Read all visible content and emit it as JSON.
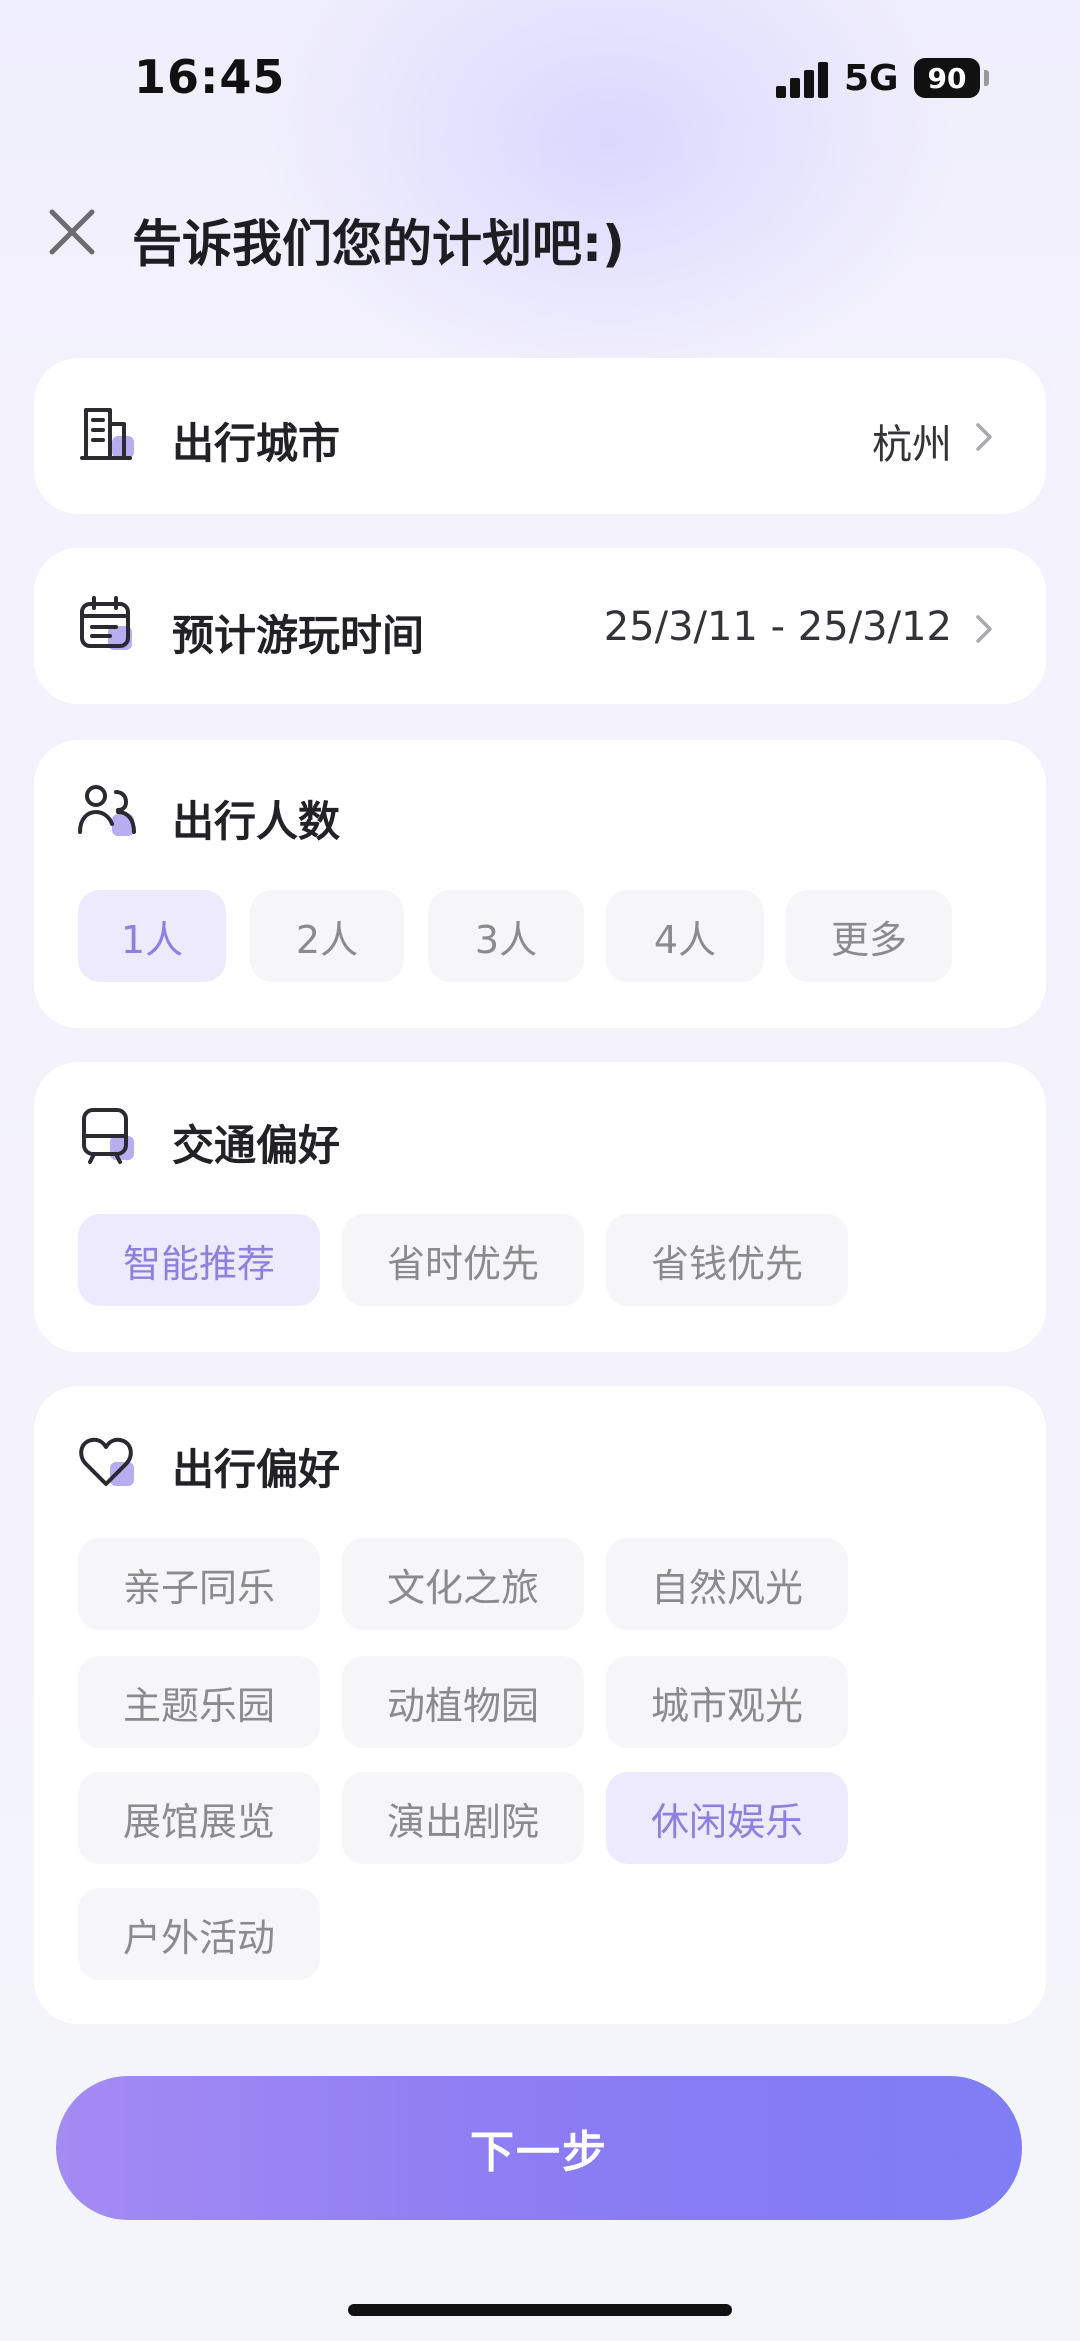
{
  "status_bar": {
    "time": "16:45",
    "network": "5G",
    "battery": "90"
  },
  "header": {
    "title": "告诉我们您的计划吧:)"
  },
  "city": {
    "label": "出行城市",
    "value": "杭州"
  },
  "dates": {
    "label": "预计游玩时间",
    "value": "25/3/11 - 25/3/12"
  },
  "people": {
    "label": "出行人数",
    "options": [
      "1人",
      "2人",
      "3人",
      "4人",
      "更多"
    ],
    "selected": "1人"
  },
  "transport": {
    "label": "交通偏好",
    "options": [
      "智能推荐",
      "省时优先",
      "省钱优先"
    ],
    "selected": "智能推荐"
  },
  "preferences": {
    "label": "出行偏好",
    "options": [
      "亲子同乐",
      "文化之旅",
      "自然风光",
      "主题乐园",
      "动植物园",
      "城市观光",
      "展馆展览",
      "演出剧院",
      "休闲娱乐",
      "户外活动"
    ],
    "selected": [
      "休闲娱乐"
    ]
  },
  "next_button": {
    "label": "下一步"
  },
  "colors": {
    "accent": "#8e7fe0",
    "chip_active_bg": "#edeafd",
    "chip_bg": "#f6f6f8",
    "icon_accent": "#b7aaf0"
  },
  "icons": {
    "city": "building-icon",
    "dates": "calendar-icon",
    "people": "people-icon",
    "transport": "bus-icon",
    "preferences": "heart-icon",
    "close": "close-icon",
    "chevron": "chevron-right-icon"
  }
}
